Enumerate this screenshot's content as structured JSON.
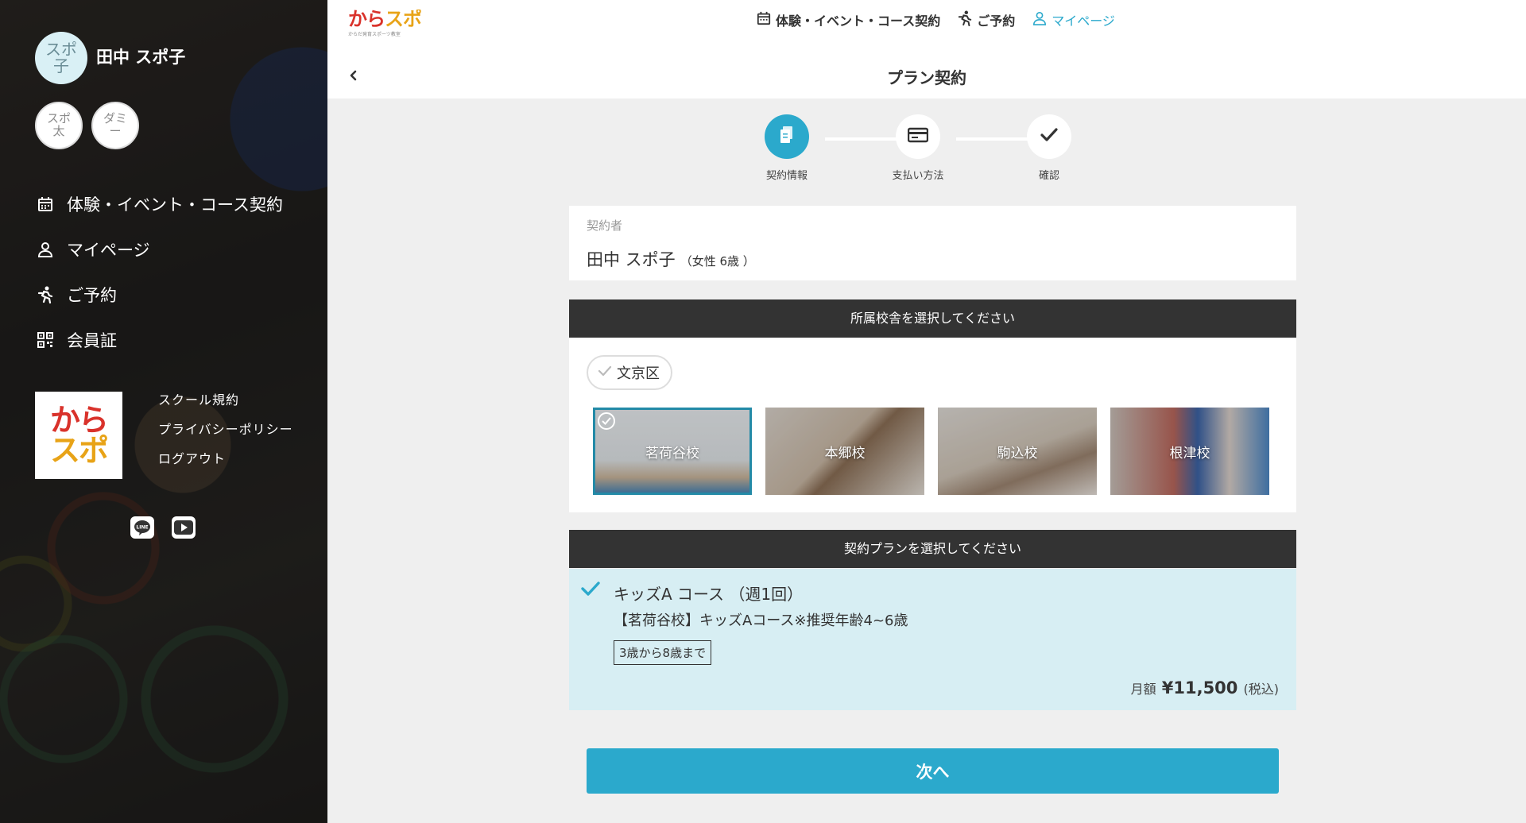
{
  "sidebar": {
    "main_user": {
      "avatar": "スポ子",
      "name": "田中 スポ子"
    },
    "other_users": [
      {
        "avatar": "スポ太"
      },
      {
        "avatar": "ダミー"
      }
    ],
    "nav": [
      {
        "label": "体験・イベント・コース契約",
        "icon": "calendar-icon"
      },
      {
        "label": "マイページ",
        "icon": "user-icon"
      },
      {
        "label": "ご予約",
        "icon": "runner-icon"
      },
      {
        "label": "会員証",
        "icon": "qr-icon"
      }
    ],
    "logo": {
      "line1": "から",
      "line2": "スポ"
    },
    "links": [
      "スクール規約",
      "プライバシーポリシー",
      "ログアウト"
    ],
    "social": [
      {
        "icon": "line-icon",
        "label": "LINE"
      },
      {
        "icon": "youtube-icon"
      }
    ]
  },
  "header": {
    "brand": "からスポ",
    "brand_sub": "からだ発育スポーツ教室",
    "nav": [
      {
        "label": "体験・イベント・コース契約",
        "icon": "calendar-icon"
      },
      {
        "label": "ご予約",
        "icon": "runner-icon"
      },
      {
        "label": "マイページ",
        "icon": "user-icon",
        "active": true
      }
    ]
  },
  "page": {
    "title": "プラン契約"
  },
  "steps": [
    {
      "label": "契約情報",
      "icon": "document-icon",
      "active": true
    },
    {
      "label": "支払い方法",
      "icon": "credit-card-icon",
      "active": false
    },
    {
      "label": "確認",
      "icon": "check-icon",
      "active": false
    }
  ],
  "contractor": {
    "label": "契約者",
    "name": "田中 スポ子",
    "detail": "（女性 6歳 ）"
  },
  "school_section": {
    "heading": "所属校舎を選択してください",
    "area_chip": "文京区",
    "schools": [
      {
        "name": "茗荷谷校",
        "selected": true
      },
      {
        "name": "本郷校",
        "selected": false
      },
      {
        "name": "駒込校",
        "selected": false
      },
      {
        "name": "根津校",
        "selected": false
      }
    ]
  },
  "plan_section": {
    "heading": "契約プランを選択してください",
    "plan": {
      "name": "キッズA コース （週1回）",
      "description": "【茗荷谷校】キッズAコース※推奨年齢4~6歳",
      "age_tag": "3歳から8歳まで",
      "price_prefix": "月額",
      "price": "¥11,500",
      "price_suffix": "(税込)"
    }
  },
  "next_button": "次へ",
  "colors": {
    "accent": "#2ba9cc",
    "dark_header": "#333333",
    "plan_bg": "#d7eef3"
  }
}
